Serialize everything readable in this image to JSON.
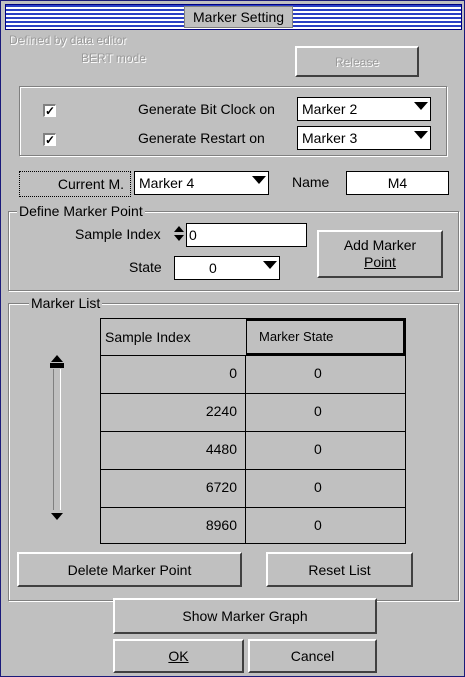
{
  "window": {
    "title": "Marker Setting"
  },
  "top": {
    "defined_by_text": "Defined by data editor",
    "bert_mode_text": "BERT mode",
    "release_label": "Release"
  },
  "generate": {
    "bit_clock": {
      "checked": true,
      "label": "Generate Bit Clock on",
      "value": "Marker 2"
    },
    "restart": {
      "checked": true,
      "label": "Generate Restart on",
      "value": "Marker 3"
    }
  },
  "current": {
    "button_label": "Current M.",
    "marker_value": "Marker 4",
    "name_label": "Name",
    "name_value": "M4"
  },
  "define": {
    "group_title": "Define Marker Point",
    "sample_index_label": "Sample Index",
    "sample_index_value": "0",
    "state_label": "State",
    "state_value": "0",
    "add_button_line1": "Add Marker",
    "add_button_line2": "Point"
  },
  "marker_list": {
    "group_title": "Marker List",
    "columns": [
      "Sample Index",
      "Marker State"
    ],
    "rows": [
      {
        "index": "0",
        "state": "0"
      },
      {
        "index": "2240",
        "state": "0"
      },
      {
        "index": "4480",
        "state": "0"
      },
      {
        "index": "6720",
        "state": "0"
      },
      {
        "index": "8960",
        "state": "0"
      }
    ],
    "delete_label": "Delete Marker Point",
    "reset_label": "Reset List"
  },
  "bottom": {
    "show_graph_label": "Show Marker Graph",
    "ok_label": "OK",
    "cancel_label": "Cancel"
  }
}
